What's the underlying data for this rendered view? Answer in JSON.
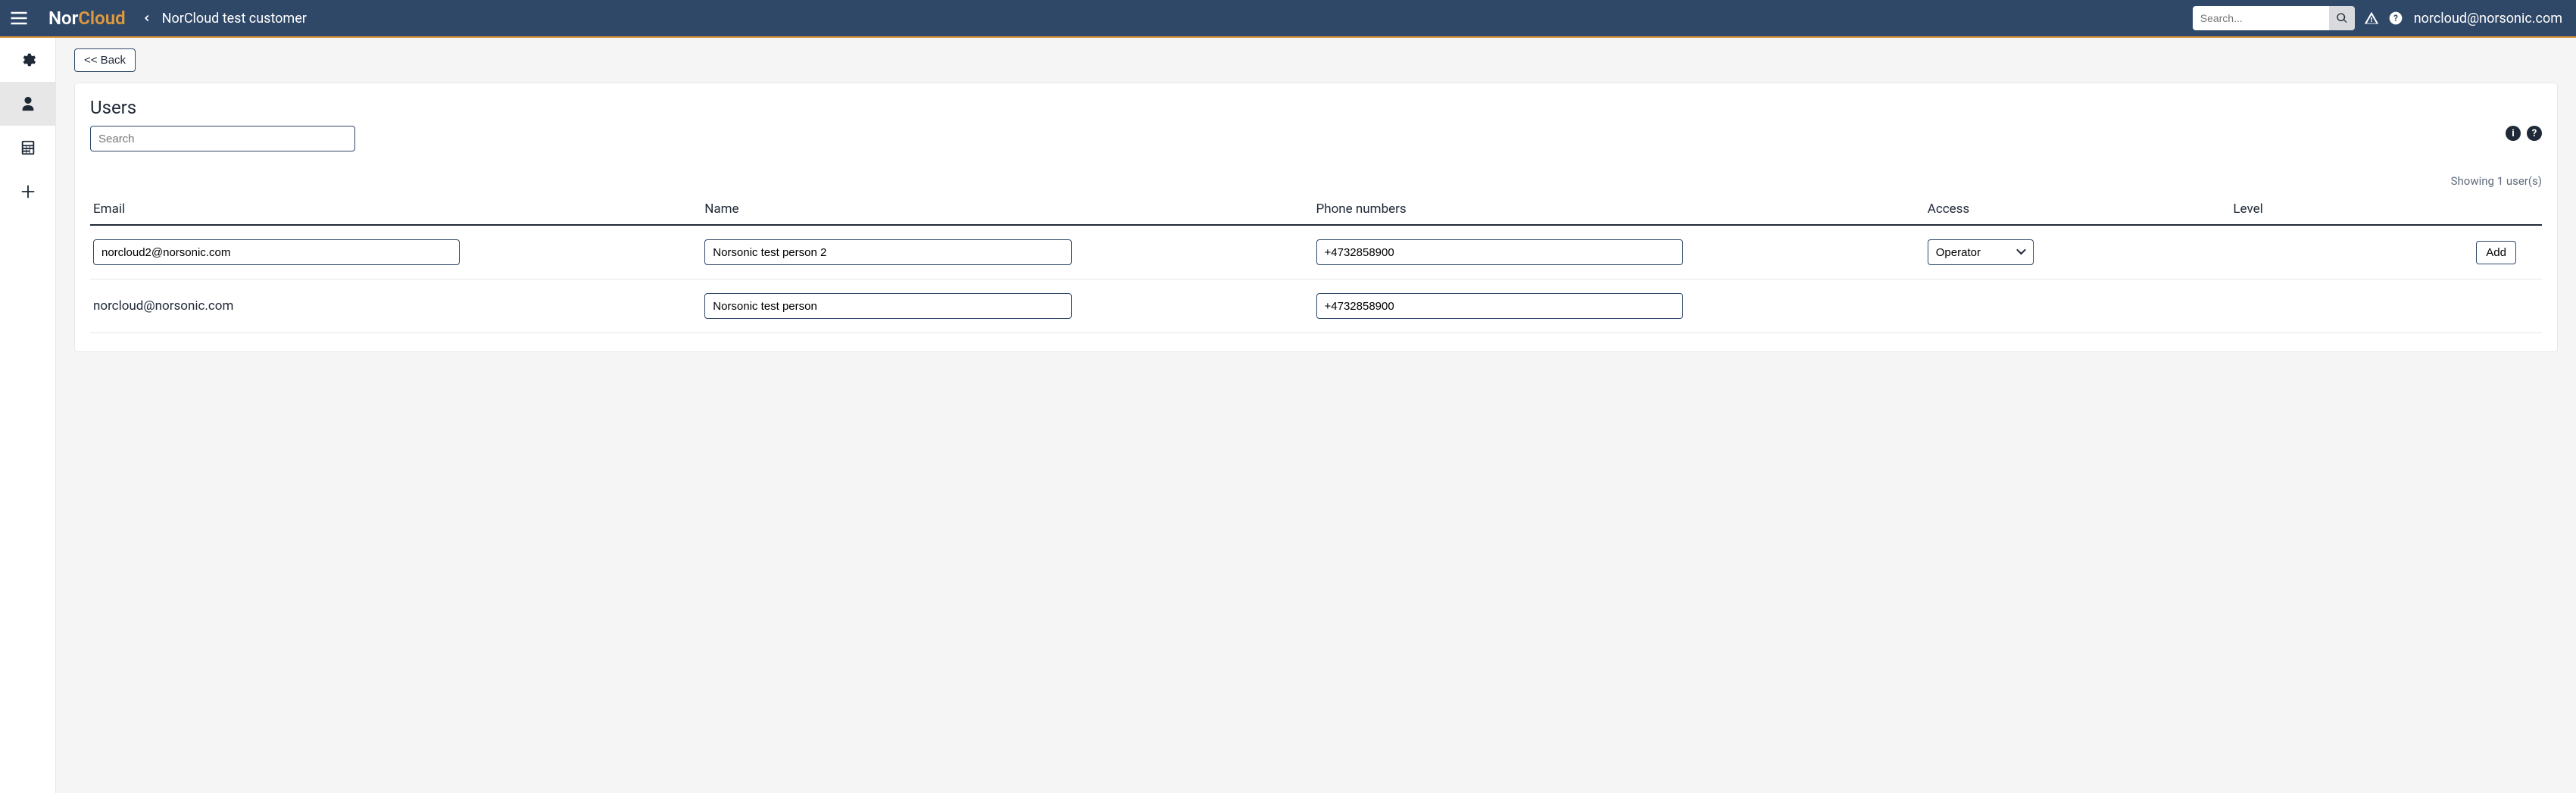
{
  "header": {
    "logo_part1": "Nor",
    "logo_part2": "Cloud",
    "breadcrumb": "NorCloud test customer",
    "search_placeholder": "Search...",
    "user_email": "norcloud@norsonic.com"
  },
  "page": {
    "back_label": "<< Back",
    "title": "Users",
    "local_search_placeholder": "Search",
    "showing_text": "Showing 1 user(s)"
  },
  "table": {
    "headers": {
      "email": "Email",
      "name": "Name",
      "phone": "Phone numbers",
      "access": "Access",
      "level": "Level"
    },
    "add_label": "Add",
    "access_options": [
      "Operator"
    ],
    "rows": [
      {
        "email": "norcloud2@norsonic.com",
        "email_editable": true,
        "name": "Norsonic test person 2",
        "phone": "+4732858900",
        "access": "Operator",
        "has_add": true
      },
      {
        "email": "norcloud@norsonic.com",
        "email_editable": false,
        "name": "Norsonic test person",
        "phone": "+4732858900",
        "access": "",
        "has_add": false
      }
    ]
  }
}
